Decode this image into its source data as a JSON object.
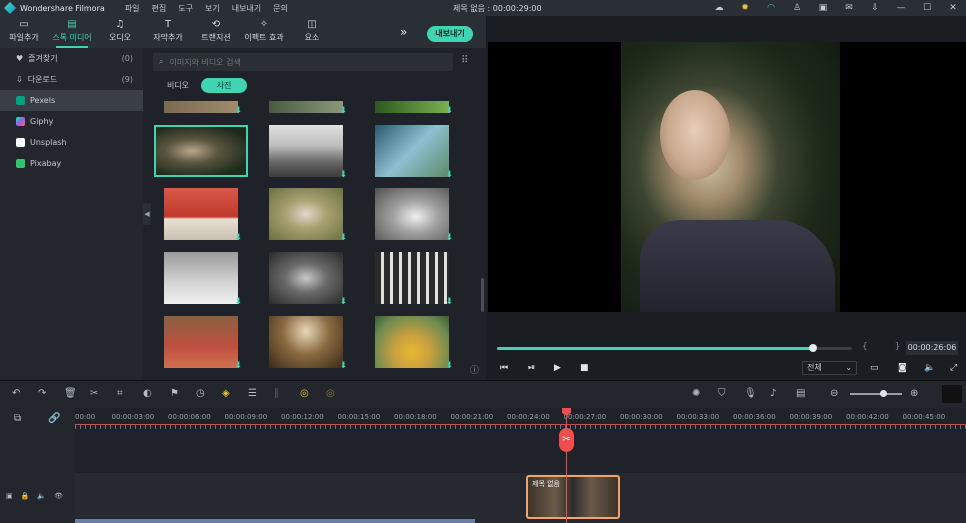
{
  "titlebar": {
    "app_name": "Wondershare Filmora",
    "menu": [
      "파일",
      "편집",
      "도구",
      "보기",
      "내보내기",
      "문의"
    ],
    "project_title": "제목 없음 : 00:00:29:00"
  },
  "toolbar": {
    "tabs": [
      {
        "label": "파일추가",
        "icon": "folder-icon"
      },
      {
        "label": "스톡 미디어",
        "icon": "stock-media-icon"
      },
      {
        "label": "오디오",
        "icon": "music-note-icon"
      },
      {
        "label": "자막추가",
        "icon": "text-icon"
      },
      {
        "label": "트랜지션",
        "icon": "transition-icon"
      },
      {
        "label": "이펙트 효과",
        "icon": "effects-icon"
      },
      {
        "label": "요소",
        "icon": "elements-icon"
      }
    ],
    "export_label": "내보내기"
  },
  "sidebar": {
    "items": [
      {
        "label": "즐겨찾기",
        "count": "(0)",
        "icon": "heart-icon",
        "color": "#c7cbd0"
      },
      {
        "label": "다운로드",
        "count": "(9)",
        "icon": "download-icon",
        "color": "#c7cbd0"
      },
      {
        "label": "Pexels",
        "count": "",
        "icon": "pexels-icon",
        "color": "#05a081"
      },
      {
        "label": "Giphy",
        "count": "",
        "icon": "giphy-icon",
        "color": "#9b59f6"
      },
      {
        "label": "Unsplash",
        "count": "",
        "icon": "unsplash-icon",
        "color": "#ffffff"
      },
      {
        "label": "Pixabay",
        "count": "",
        "icon": "pixabay-icon",
        "color": "#2ec66d"
      }
    ]
  },
  "search": {
    "placeholder": "이미지와 비디오 검색"
  },
  "segment": {
    "video": "비디오",
    "photo": "사진"
  },
  "preview": {
    "timecode": "00:00:26:06",
    "quality": "전체",
    "progress": 0.89
  },
  "timeline": {
    "ruler": [
      "00:00",
      "00:00:03:00",
      "00:00:06:00",
      "00:00:09:00",
      "00:00:12:00",
      "00:00:15:00",
      "00:00:18:00",
      "00:00:21:00",
      "00:00:24:00",
      "00:00:27:00",
      "00:00:30:00",
      "00:00:33:00",
      "00:00:36:00",
      "00:00:39:00",
      "00:00:42:00",
      "00:00:45:00"
    ],
    "clip_label": "제목 없음"
  },
  "colors": {
    "accent": "#3fd5b3",
    "playhead": "#f04e4e",
    "clip_border": "#f0a46c"
  }
}
